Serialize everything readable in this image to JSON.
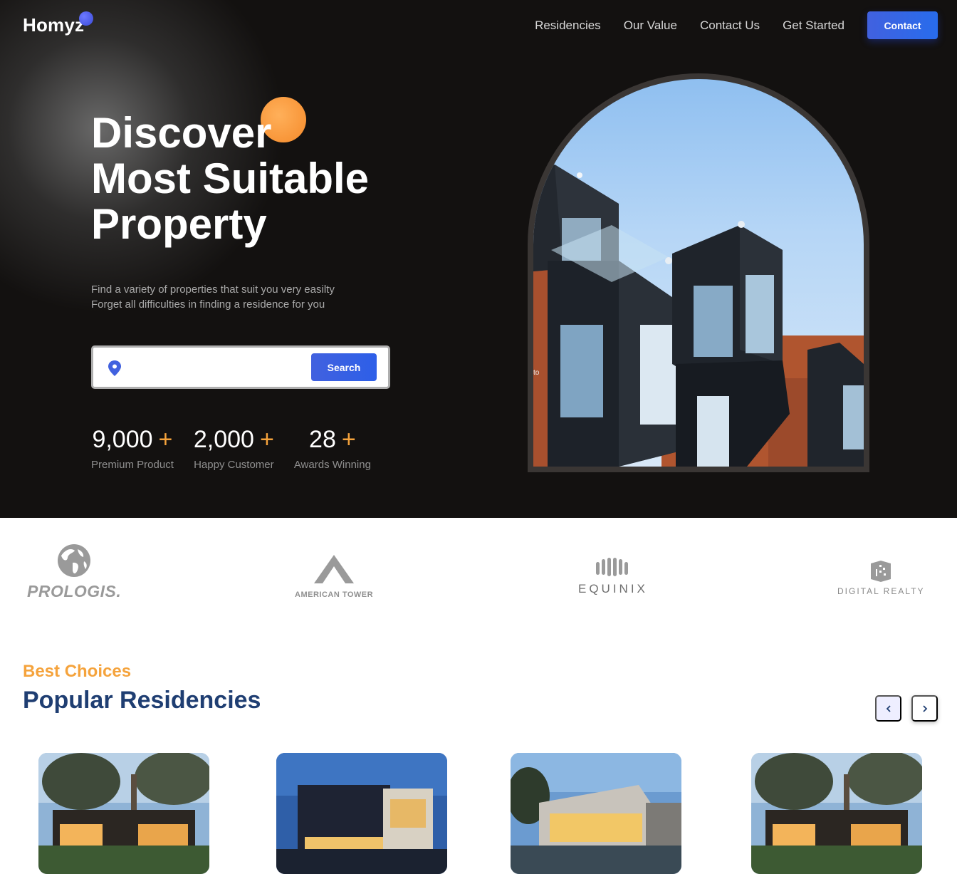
{
  "header": {
    "logo": "Homyz",
    "nav": [
      "Residencies",
      "Our Value",
      "Contact Us",
      "Get Started"
    ],
    "contact_button": "Contact"
  },
  "hero": {
    "title_lines": [
      "Discover",
      "Most Suitable",
      "Property"
    ],
    "subtitle_lines": [
      "Find a variety of properties that suit you very easilty",
      "Forget all difficulties in finding a residence for you"
    ],
    "search": {
      "value": "",
      "placeholder": "",
      "button": "Search",
      "icon": "location-pin-icon"
    },
    "stats": [
      {
        "number": "9,000",
        "plus": "+",
        "label": "Premium Product"
      },
      {
        "number": "2,000",
        "plus": "+",
        "label": "Happy Customer"
      },
      {
        "number": "28",
        "plus": "+",
        "label": "Awards Winning"
      }
    ],
    "image_caption": "to"
  },
  "partners": [
    "PROLOGIS.",
    "AMERICAN TOWER",
    "EQUINIX",
    "DIGITAL REALTY"
  ],
  "residencies": {
    "eyebrow": "Best Choices",
    "title": "Popular Residencies",
    "prev_icon": "chevron-left-icon",
    "next_icon": "chevron-right-icon"
  },
  "colors": {
    "hero_bg": "#131110",
    "accent_blue": "#4161df",
    "accent_orange": "#f5a33c",
    "title_navy": "#1f3e72"
  }
}
